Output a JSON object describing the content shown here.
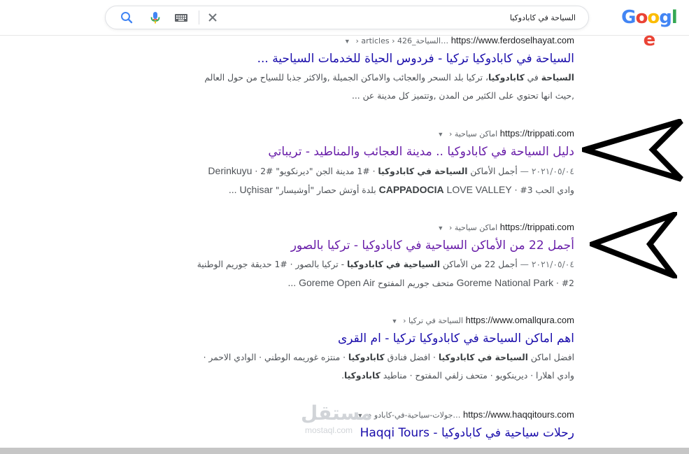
{
  "header": {
    "logo_letters": [
      "G",
      "o",
      "o",
      "g",
      "l",
      "e"
    ],
    "logo_colors": [
      "#4285f4",
      "#ea4335",
      "#fbbc05",
      "#4285f4",
      "#34a853",
      "#ea4335"
    ],
    "search_value": "السياحة في كابادوكيا",
    "icons": [
      "close-icon",
      "keyboard-icon",
      "mic-icon",
      "search-icon"
    ]
  },
  "results": [
    {
      "url": "https://www.ferdoselhayat.com",
      "path": " › articles › 426_السياحة…",
      "title": "السياحة في كابادوكيا تركيا - فردوس الحياة للخدمات السياحية ...",
      "visited": false,
      "lines": [
        [
          {
            "t": "السياحة",
            "b": true
          },
          {
            "t": " في "
          },
          {
            "t": "كابادوكيا",
            "b": true
          },
          {
            "t": "، تركيا بلد السحر والعجائب والاماكن الجميلة ,والاكثر جذبا للسياح من حول العالم"
          }
        ],
        [
          {
            "t": ",حيث انها تحتوي على الكثير من المدن ,وتتميز كل مدينة عن ..."
          }
        ]
      ]
    },
    {
      "url": "https://trippati.com",
      "path": " › اماكن سياحية",
      "title": "دليل السياحة في كابادوكيا .. مدينة العجائب والمناطيد - تريباتي",
      "visited": true,
      "lines": [
        [
          {
            "t": "٢٠٢١/٠٥/٠٤ — ",
            "d": true
          },
          {
            "t": "أجمل الأماكن "
          },
          {
            "t": "السياحة في كابادوكيا",
            "b": true
          },
          {
            "t": " · #1 مدينة الجن \"ديرنكويو\" #2 · "
          },
          {
            "t": "Derinkuyu",
            "l": true
          }
        ],
        [
          {
            "t": "وادي الحب "
          },
          {
            "t": "CAPPADOCIA",
            "b": true,
            "l": true
          },
          {
            "t": " LOVE VALLEY",
            "l": true
          },
          {
            "t": " · #3 بلدة أوتش حصار \"أوشيسار\" "
          },
          {
            "t": "Uçhisar ...",
            "l": true
          }
        ]
      ]
    },
    {
      "url": "https://trippati.com",
      "path": " › اماكن سياحية",
      "title": "أجمل 22 من الأماكن السياحية في كابادوكيا - تركيا بالصور",
      "visited": true,
      "lines": [
        [
          {
            "t": "٢٠٢١/٠٥/٠٤ — ",
            "d": true
          },
          {
            "t": "أجمل 22 من الأماكن "
          },
          {
            "t": "السياحية في كابادوكيا",
            "b": true
          },
          {
            "t": " - تركيا بالصور · #1 حديقة جوريم الوطنية"
          }
        ],
        [
          {
            "t": "Goreme National Park",
            "l": true
          },
          {
            "t": " · #2 متحف جوريم المفتوح "
          },
          {
            "t": "Goreme Open Air ...",
            "l": true
          }
        ]
      ]
    },
    {
      "url": "https://www.omallqura.com",
      "path": " › السياحة في تركيا",
      "title": "اهم اماكن السياحة في كابادوكيا تركيا - ام القرى",
      "visited": false,
      "lines": [
        [
          {
            "t": "افضل اماكن "
          },
          {
            "t": "السياحة في كابادوكيا",
            "b": true
          },
          {
            "t": " · افضل فنادق "
          },
          {
            "t": "كابادوكيا",
            "b": true
          },
          {
            "t": " · منتزه غوريمه الوطني · الوادي الاحمر ·"
          }
        ],
        [
          {
            "t": "وادي اهلارا · ديرينكويو · متحف زلفي المفتوح · مناطيد "
          },
          {
            "t": "كابادوكيا",
            "b": true
          },
          {
            "t": "."
          }
        ]
      ]
    },
    {
      "url": "https://www.haqqitours.com",
      "path": " › جولات-سياحية-في-كابادو…",
      "title": "رحلات سياحية في كابادوكيا - Haqqi Tours",
      "visited": false,
      "lines": []
    }
  ],
  "overlay": {
    "watermark_ar": "مستقل",
    "watermark_en": "mostaql.com",
    "arrow_color": "#000000"
  }
}
